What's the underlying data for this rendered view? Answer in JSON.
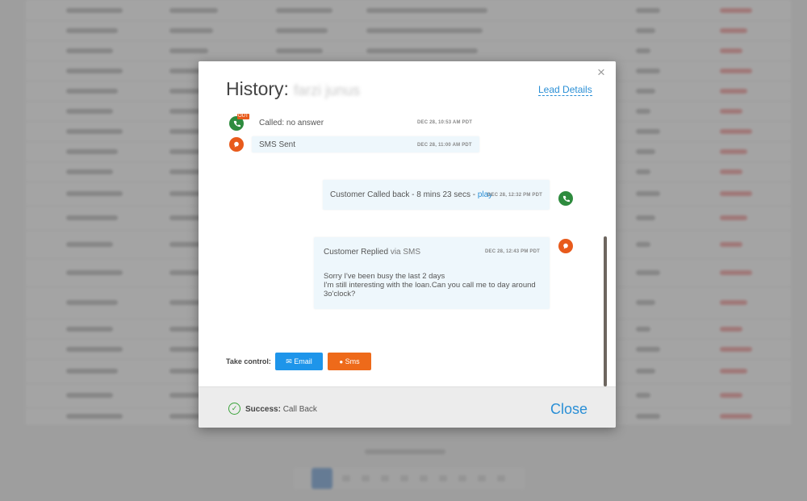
{
  "modal": {
    "title_prefix": "History:",
    "title_name": "farzi junus",
    "close_icon": "×",
    "lead_details": "Lead Details"
  },
  "events": [
    {
      "icon": "phone-icon",
      "badge": "OUT",
      "text": "Called: no answer",
      "time": "DEC 28, 10:53 AM PDT"
    },
    {
      "icon": "sms-icon",
      "text": "SMS Sent",
      "time": "DEC 28, 11:00 AM PDT"
    },
    {
      "icon": "phone-icon",
      "text": "Customer Called back - 8 mins 23 secs - ",
      "link": "play",
      "time": "DEC 28, 12:32 PM PDT"
    },
    {
      "icon": "sms-icon",
      "text_main": "Customer Replied",
      "text_suffix": " via SMS",
      "time": "DEC 28, 12:43 PM PDT",
      "message_lines": [
        "Sorry I've been busy the last 2 days",
        "I'm still interesting with the loan.Can you call me to day around",
        "3o'clock?"
      ]
    }
  ],
  "take_control": {
    "label": "Take control:",
    "email_icon": "✉",
    "email_label": "Email",
    "sms_icon": "●",
    "sms_label": "Sms"
  },
  "footer": {
    "success_label": "Success:",
    "success_value": " Call Back",
    "close_label": "Close"
  },
  "colors": {
    "accent_blue": "#2a8fd6",
    "email_button": "#1e95ea",
    "sms_button": "#ee6a1a",
    "call_green": "#2e8b3e",
    "sms_orange": "#e85a1b",
    "success_green": "#3aa33a"
  }
}
